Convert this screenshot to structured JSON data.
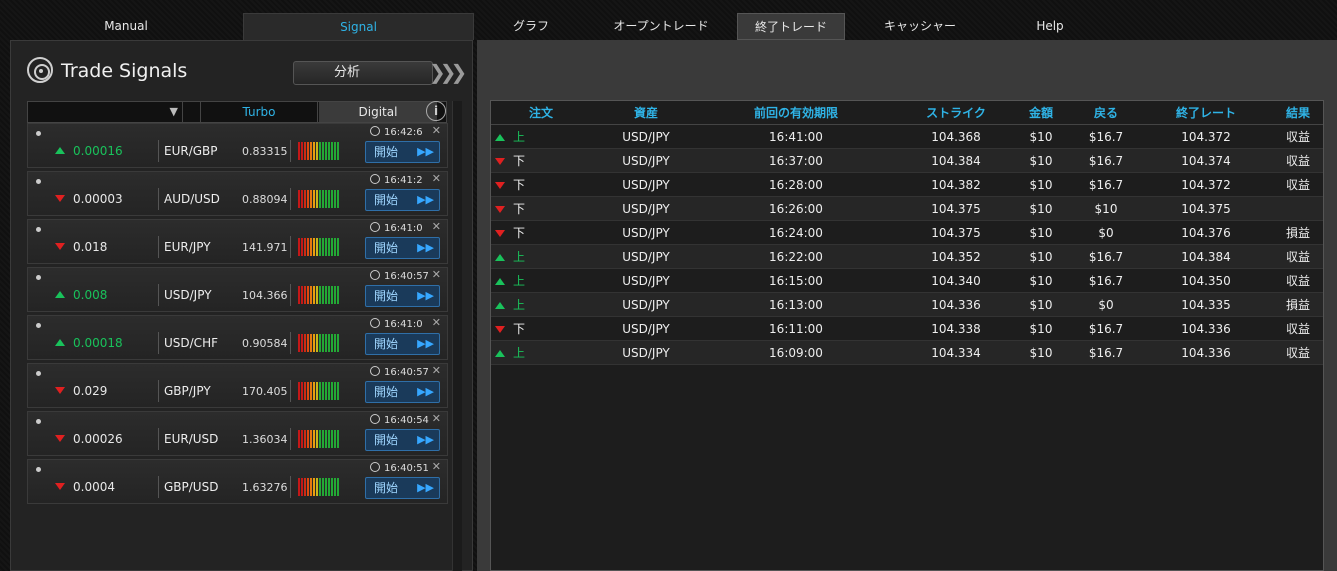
{
  "nav": {
    "tabs": [
      {
        "label": "Manual"
      },
      {
        "label": "Signal"
      },
      {
        "label": "グラフ"
      },
      {
        "label": "オープントレード"
      },
      {
        "label": "終了トレード"
      },
      {
        "label": "キャッシャー"
      },
      {
        "label": "Help"
      }
    ]
  },
  "signals_panel": {
    "title": "Trade Signals",
    "analysis_button": "分析",
    "subtabs": {
      "turbo": "Turbo",
      "digital": "Digital"
    },
    "info_icon": "i",
    "cards": [
      {
        "dir": "up",
        "value": "0.00016",
        "pair": "EUR/GBP",
        "price": "0.83315",
        "time": "16:42:6",
        "button": "開始"
      },
      {
        "dir": "dn",
        "value": "0.00003",
        "pair": "AUD/USD",
        "price": "0.88094",
        "time": "16:41:2",
        "button": "開始"
      },
      {
        "dir": "dn",
        "value": "0.018",
        "pair": "EUR/JPY",
        "price": "141.971",
        "time": "16:41:0",
        "button": "開始"
      },
      {
        "dir": "up",
        "value": "0.008",
        "pair": "USD/JPY",
        "price": "104.366",
        "time": "16:40:57",
        "button": "開始"
      },
      {
        "dir": "up",
        "value": "0.00018",
        "pair": "USD/CHF",
        "price": "0.90584",
        "time": "16:41:0",
        "button": "開始"
      },
      {
        "dir": "dn",
        "value": "0.029",
        "pair": "GBP/JPY",
        "price": "170.405",
        "time": "16:40:57",
        "button": "開始"
      },
      {
        "dir": "dn",
        "value": "0.00026",
        "pair": "EUR/USD",
        "price": "1.36034",
        "time": "16:40:54",
        "button": "開始"
      },
      {
        "dir": "dn",
        "value": "0.0004",
        "pair": "GBP/USD",
        "price": "1.63276",
        "time": "16:40:51",
        "button": "開始"
      }
    ]
  },
  "trades_table": {
    "headers": [
      "注文",
      "資産",
      "前回の有効期限",
      "ストライク",
      "金額",
      "戻る",
      "終了レート",
      "結果"
    ],
    "rows": [
      {
        "dir": "up",
        "order": "上",
        "asset": "USD/JPY",
        "expiry": "16:41:00",
        "strike": "104.368",
        "amount": "$10",
        "return": "$16.7",
        "close": "104.372",
        "result": "収益"
      },
      {
        "dir": "dn",
        "order": "下",
        "asset": "USD/JPY",
        "expiry": "16:37:00",
        "strike": "104.384",
        "amount": "$10",
        "return": "$16.7",
        "close": "104.374",
        "result": "収益"
      },
      {
        "dir": "dn",
        "order": "下",
        "asset": "USD/JPY",
        "expiry": "16:28:00",
        "strike": "104.382",
        "amount": "$10",
        "return": "$16.7",
        "close": "104.372",
        "result": "収益"
      },
      {
        "dir": "dn",
        "order": "下",
        "asset": "USD/JPY",
        "expiry": "16:26:00",
        "strike": "104.375",
        "amount": "$10",
        "return": "$10",
        "close": "104.375",
        "result": ""
      },
      {
        "dir": "dn",
        "order": "下",
        "asset": "USD/JPY",
        "expiry": "16:24:00",
        "strike": "104.375",
        "amount": "$10",
        "return": "$0",
        "close": "104.376",
        "result": "損益"
      },
      {
        "dir": "up",
        "order": "上",
        "asset": "USD/JPY",
        "expiry": "16:22:00",
        "strike": "104.352",
        "amount": "$10",
        "return": "$16.7",
        "close": "104.384",
        "result": "収益"
      },
      {
        "dir": "up",
        "order": "上",
        "asset": "USD/JPY",
        "expiry": "16:15:00",
        "strike": "104.340",
        "amount": "$10",
        "return": "$16.7",
        "close": "104.350",
        "result": "収益"
      },
      {
        "dir": "up",
        "order": "上",
        "asset": "USD/JPY",
        "expiry": "16:13:00",
        "strike": "104.336",
        "amount": "$10",
        "return": "$0",
        "close": "104.335",
        "result": "損益"
      },
      {
        "dir": "dn",
        "order": "下",
        "asset": "USD/JPY",
        "expiry": "16:11:00",
        "strike": "104.338",
        "amount": "$10",
        "return": "$16.7",
        "close": "104.336",
        "result": "収益"
      },
      {
        "dir": "up",
        "order": "上",
        "asset": "USD/JPY",
        "expiry": "16:09:00",
        "strike": "104.334",
        "amount": "$10",
        "return": "$16.7",
        "close": "104.336",
        "result": "収益"
      }
    ]
  },
  "colors": {
    "accent": "#2fb3e6",
    "up": "#19c25b",
    "down": "#e02020"
  }
}
